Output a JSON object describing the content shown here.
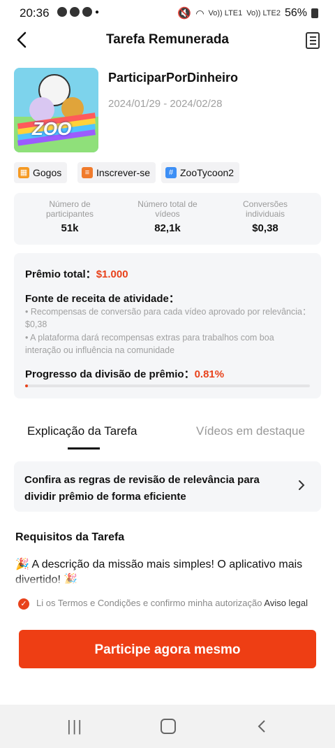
{
  "status": {
    "time": "20:36",
    "battery": "56%",
    "carrier1": "Vo)) LTE1",
    "carrier2": "Vo)) LTE2"
  },
  "header": {
    "title": "Tarefa Remunerada"
  },
  "app": {
    "name": "ParticiparPorDinheiro",
    "dates": "2024/01/29 - 2024/02/28",
    "logo_text": "ZOO"
  },
  "tags": [
    {
      "label": "Gogos",
      "icon": "grid-icon",
      "color": "#f59a23"
    },
    {
      "label": "Inscrever-se",
      "icon": "list-icon",
      "color": "#f07b2c"
    },
    {
      "label": "ZooTycoon2",
      "icon": "hashtag-icon",
      "color": "#3d8ff5"
    }
  ],
  "stats": [
    {
      "label": "Número de participantes",
      "value": "51k"
    },
    {
      "label": "Número total de vídeos",
      "value": "82,1k"
    },
    {
      "label": "Conversões individuais",
      "value": "$0,38"
    }
  ],
  "prize": {
    "total_label": "Prêmio total：",
    "total_value": "$1.000",
    "source_title": "Fonte de receita de atividade：",
    "bullet1": "• Recompensas de conversão para cada vídeo aprovado por relevância：$0,38",
    "bullet2": "• A plataforma dará recompensas extras para trabalhos com boa interação ou influência na comunidade",
    "progress_label": "Progresso da divisão de prêmio：",
    "progress_value": "0.81%",
    "progress_fraction": 0.0081
  },
  "tabs": {
    "tab1": "Explicação da Tarefa",
    "tab2": "Vídeos em destaque"
  },
  "rules": {
    "text": "Confira as regras de revisão de relevância para dividir prêmio de forma eficiente"
  },
  "requirements": {
    "title": "Requisitos da Tarefa",
    "desc": "🎉 A descrição da missão mais simples! O aplicativo mais divertido! 🎉"
  },
  "terms": {
    "text": "Li os Termos e Condições e confirmo minha autorização",
    "link": "Aviso legal"
  },
  "cta": {
    "label": "Participe agora mesmo"
  },
  "colors": {
    "accent": "#ee3e14"
  }
}
